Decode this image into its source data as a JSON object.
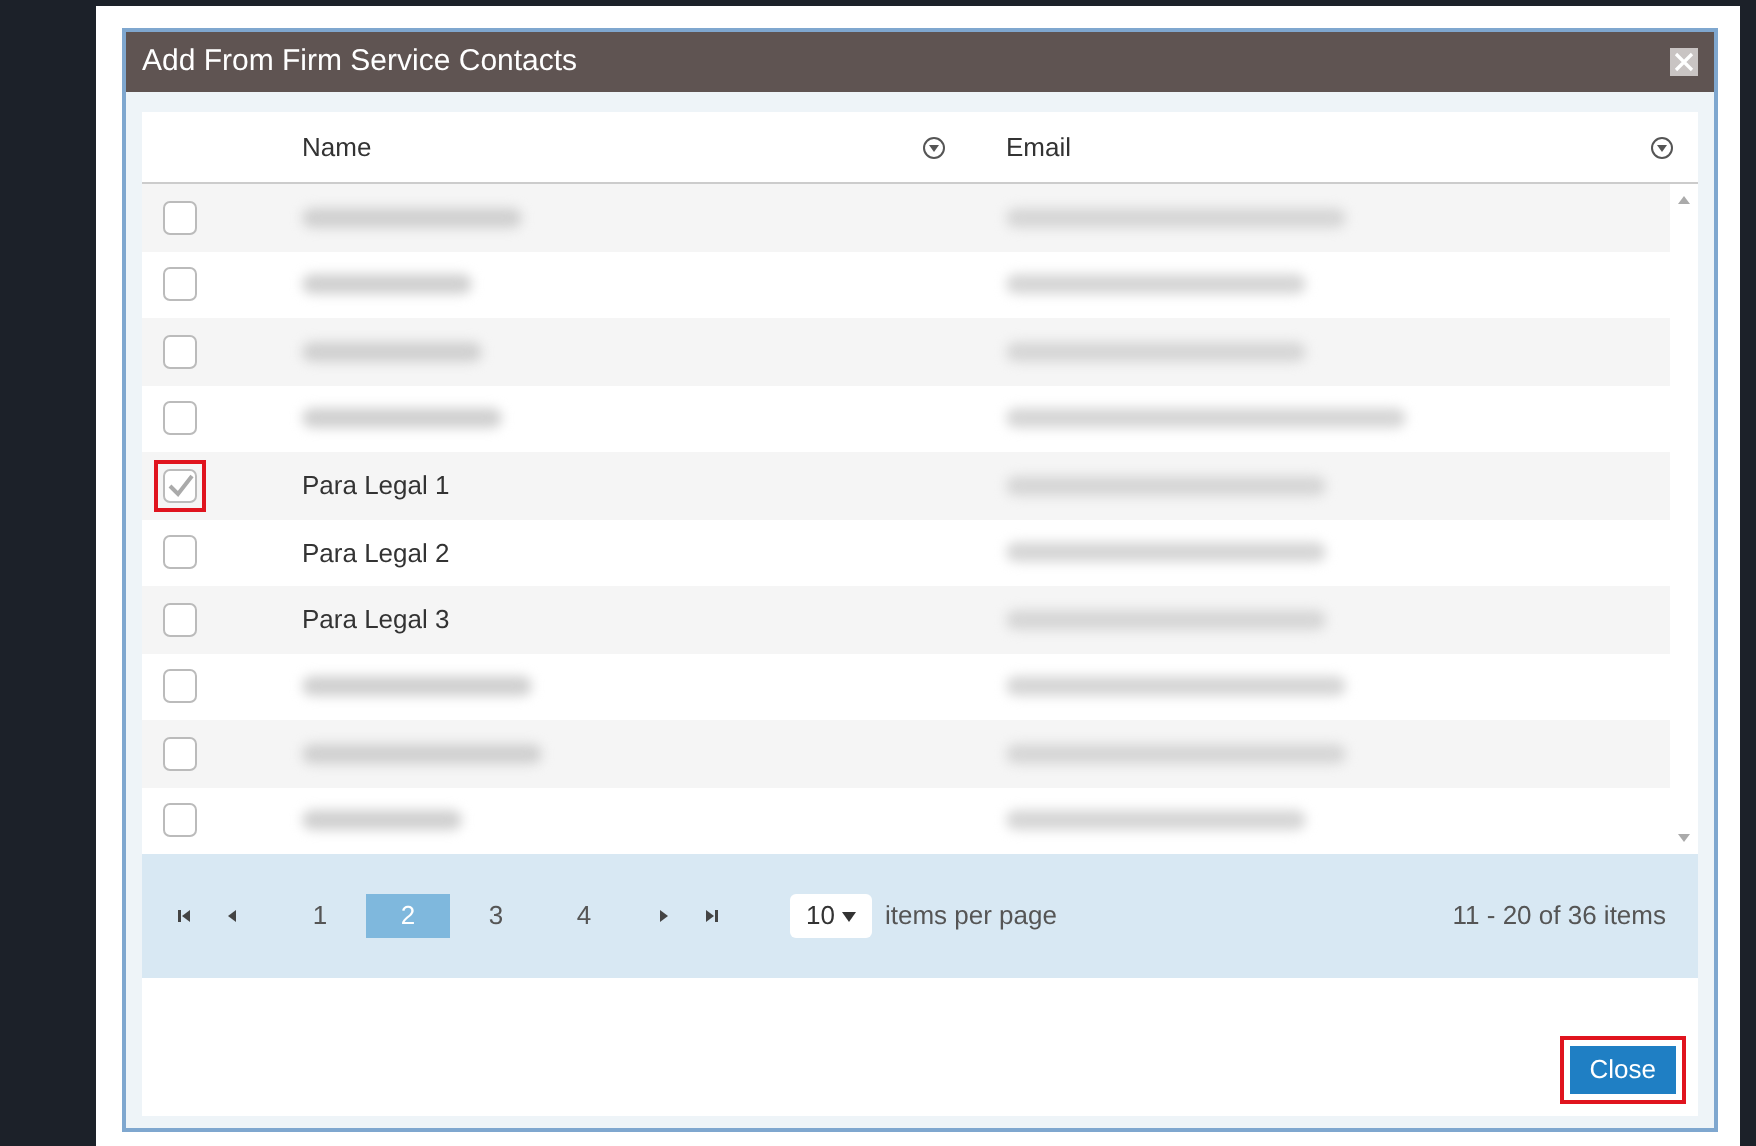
{
  "dialog": {
    "title": "Add From Firm Service Contacts"
  },
  "table": {
    "columns": [
      {
        "label": "Name"
      },
      {
        "label": "Email"
      }
    ],
    "rows": [
      {
        "kind": "redacted",
        "checked": false
      },
      {
        "kind": "redacted",
        "checked": false
      },
      {
        "kind": "redacted",
        "checked": false
      },
      {
        "kind": "redacted",
        "checked": false
      },
      {
        "kind": "named",
        "name": "Para Legal 1",
        "checked": true
      },
      {
        "kind": "named",
        "name": "Para Legal 2",
        "checked": false
      },
      {
        "kind": "named",
        "name": "Para Legal 3",
        "checked": false
      },
      {
        "kind": "redacted",
        "checked": false
      },
      {
        "kind": "redacted",
        "checked": false
      },
      {
        "kind": "redacted",
        "checked": false
      }
    ]
  },
  "pager": {
    "pages": [
      {
        "label": "1",
        "selected": false
      },
      {
        "label": "2",
        "selected": true
      },
      {
        "label": "3",
        "selected": false
      },
      {
        "label": "4",
        "selected": false
      }
    ],
    "page_size": "10",
    "page_size_label": "items per page",
    "summary": "11 - 20 of 36 items"
  },
  "buttons": [
    {
      "label": "Close"
    }
  ]
}
